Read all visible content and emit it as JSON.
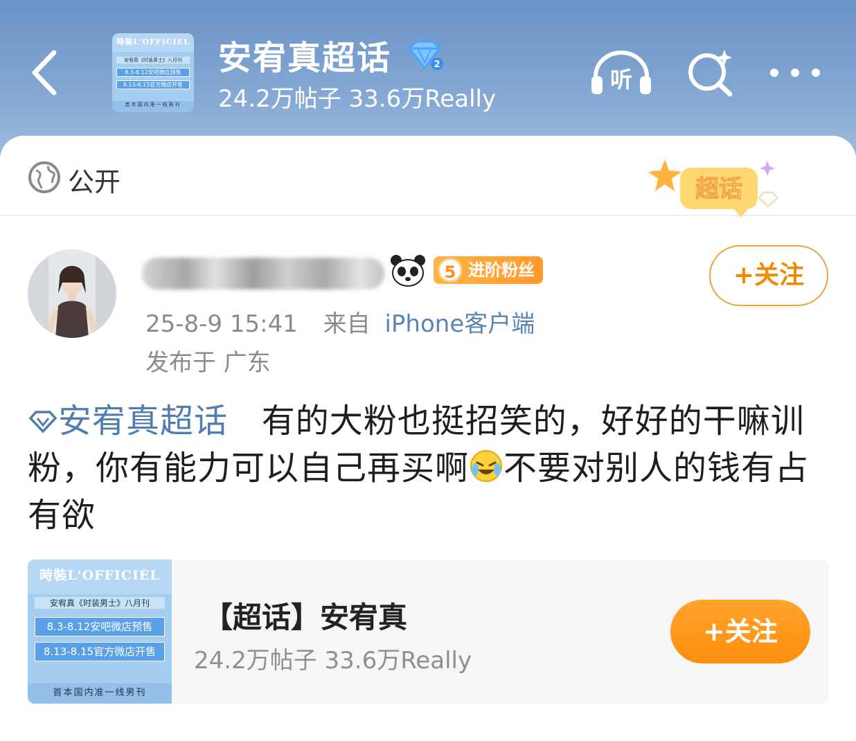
{
  "header": {
    "title": "安宥真超话",
    "stats": "24.2万帖子 33.6万Really",
    "level_icon": "diamond-level-2",
    "level_number": "2"
  },
  "cover": {
    "masthead": "時裝L'OFFICIEL",
    "line1": "安宥真《时装男士》八月刊",
    "line2": "8.3-8.12安吧微店预售",
    "line3": "8.13-8.15官方微店开售",
    "footer": "首本国内准一线男刊"
  },
  "visibility": {
    "label": "公开",
    "badge_text": "超话"
  },
  "post": {
    "fan_level": "5",
    "fan_badge": "进阶粉丝",
    "follow_label": "+关注",
    "time": "25-8-9 15:41",
    "from_label": "来自",
    "source": "iPhone客户端",
    "location": "发布于 广东",
    "topic_link": "安宥真超话",
    "text_part1": "有的大粉也挺招笑的，好好的干嘛训粉，你有能力可以自己再买啊",
    "text_part2": "不要对别人的钱有占有欲"
  },
  "topic_card": {
    "title": "【超话】安宥真",
    "stats": "24.2万帖子 33.6万Really",
    "follow_label": "+关注"
  },
  "colors": {
    "header_top": "#6a93c6",
    "accent_orange": "#ff8e0e",
    "link_blue": "#507daf"
  }
}
